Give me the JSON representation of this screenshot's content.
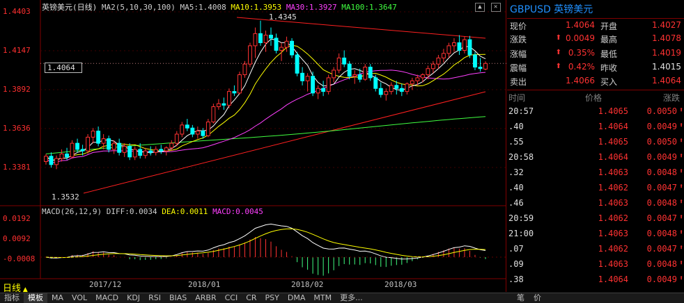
{
  "instrument": {
    "name": "英镑美元",
    "period": "日线",
    "code": "GBPUSD",
    "panel_title_name": "英镑美元"
  },
  "ma_header": {
    "title": "英镑美元(日线)",
    "ma2": "MA2(5,10,30,100)",
    "ma5": "MA5:1.4008",
    "ma10": "MA10:1.3953",
    "ma30": "MA30:1.3927",
    "ma100": "MA100:1.3647"
  },
  "macd_header": {
    "title": "MACD(26,12,9)",
    "diff": "DIFF:0.0034",
    "dea": "DEA:0.0011",
    "macd": "MACD:0.0045"
  },
  "price_axis": [
    "1.4403",
    "1.4147",
    "1.3892",
    "1.3636",
    "1.3381"
  ],
  "macd_axis": [
    "0.0192",
    "0.0092",
    "-0.0008"
  ],
  "x_axis": [
    "2017/12",
    "2018/01",
    "2018/02",
    "2018/03"
  ],
  "current_price_tag": "1.4064",
  "high_marker": "1.4345",
  "low_marker": "1.3532",
  "period_button": "日线",
  "window_controls": [
    "▲",
    "✕"
  ],
  "quote": {
    "rows": [
      {
        "l1": "现价",
        "v1": "1.4064",
        "v1_arrow": "",
        "l2": "开盘",
        "v2": "1.4027"
      },
      {
        "l1": "涨跌",
        "v1": "0.0049",
        "v1_arrow": "⬆",
        "l2": "最高",
        "v2": "1.4078"
      },
      {
        "l1": "涨幅",
        "v1": "0.35%",
        "v1_arrow": "⬆",
        "l2": "最低",
        "v2": "1.4019"
      },
      {
        "l1": "震幅",
        "v1": "0.42%",
        "v1_arrow": "⬆",
        "l2": "昨收",
        "v2": "1.4015"
      },
      {
        "l1": "卖出",
        "v1": "1.4066",
        "v1_arrow": "",
        "l2": "买入",
        "v2": "1.4064"
      }
    ]
  },
  "ticks_header": {
    "time": "时间",
    "price": "价格",
    "change": "涨跌"
  },
  "ticks": [
    {
      "time": "20:57",
      "price": "1.4065",
      "change": "0.0050"
    },
    {
      "time": ".40",
      "price": "1.4064",
      "change": "0.0049"
    },
    {
      "time": ".55",
      "price": "1.4065",
      "change": "0.0050"
    },
    {
      "time": "20:58",
      "price": "1.4064",
      "change": "0.0049"
    },
    {
      "time": ".32",
      "price": "1.4063",
      "change": "0.0048"
    },
    {
      "time": ".40",
      "price": "1.4062",
      "change": "0.0047"
    },
    {
      "time": ".46",
      "price": "1.4063",
      "change": "0.0048"
    },
    {
      "time": "20:59",
      "price": "1.4062",
      "change": "0.0047"
    },
    {
      "time": "21:00",
      "price": "1.4063",
      "change": "0.0048"
    },
    {
      "time": ".07",
      "price": "1.4062",
      "change": "0.0047"
    },
    {
      "time": ".09",
      "price": "1.4063",
      "change": "0.0048"
    },
    {
      "time": ".38",
      "price": "1.4064",
      "change": "0.0049"
    }
  ],
  "bottom_tabs": [
    "指标",
    "模板",
    "MA",
    "VOL",
    "MACD",
    "KDJ",
    "RSI",
    "BIAS",
    "ARBR",
    "CCI",
    "CR",
    "PSY",
    "DMA",
    "MTM",
    "更多..."
  ],
  "bottom_right_tabs": [
    "笔",
    "价"
  ],
  "colors": {
    "up": "#ff3232",
    "down": "#00ffff",
    "ma5": "#ffffff",
    "ma10": "#ffff00",
    "ma30": "#ff40ff",
    "ma100": "#40ff40",
    "trendline": "#ff2020"
  },
  "chart_data": {
    "type": "candlestick",
    "ylim": [
      1.3532,
      1.4403
    ],
    "candles": [
      [
        1.342,
        1.347,
        1.34,
        1.3455
      ],
      [
        1.3455,
        1.348,
        1.338,
        1.34
      ],
      [
        1.34,
        1.346,
        1.337,
        1.344
      ],
      [
        1.344,
        1.35,
        1.342,
        1.347
      ],
      [
        1.347,
        1.351,
        1.343,
        1.345
      ],
      [
        1.345,
        1.356,
        1.344,
        1.354
      ],
      [
        1.354,
        1.357,
        1.348,
        1.35
      ],
      [
        1.35,
        1.353,
        1.346,
        1.349
      ],
      [
        1.349,
        1.36,
        1.347,
        1.358
      ],
      [
        1.358,
        1.364,
        1.354,
        1.362
      ],
      [
        1.362,
        1.365,
        1.352,
        1.354
      ],
      [
        1.354,
        1.36,
        1.35,
        1.357
      ],
      [
        1.357,
        1.359,
        1.348,
        1.35
      ],
      [
        1.35,
        1.356,
        1.347,
        1.354
      ],
      [
        1.354,
        1.357,
        1.346,
        1.348
      ],
      [
        1.348,
        1.354,
        1.345,
        1.352
      ],
      [
        1.352,
        1.354,
        1.343,
        1.345
      ],
      [
        1.345,
        1.352,
        1.343,
        1.35
      ],
      [
        1.35,
        1.354,
        1.344,
        1.346
      ],
      [
        1.346,
        1.351,
        1.344,
        1.349
      ],
      [
        1.349,
        1.352,
        1.346,
        1.348
      ],
      [
        1.348,
        1.352,
        1.346,
        1.35
      ],
      [
        1.35,
        1.353,
        1.347,
        1.349
      ],
      [
        1.349,
        1.352,
        1.346,
        1.351
      ],
      [
        1.351,
        1.356,
        1.349,
        1.354
      ],
      [
        1.354,
        1.362,
        1.352,
        1.36
      ],
      [
        1.36,
        1.368,
        1.358,
        1.366
      ],
      [
        1.366,
        1.37,
        1.362,
        1.364
      ],
      [
        1.364,
        1.366,
        1.358,
        1.36
      ],
      [
        1.36,
        1.365,
        1.357,
        1.362
      ],
      [
        1.362,
        1.364,
        1.357,
        1.359
      ],
      [
        1.359,
        1.37,
        1.358,
        1.368
      ],
      [
        1.368,
        1.38,
        1.367,
        1.378
      ],
      [
        1.378,
        1.383,
        1.376,
        1.38
      ],
      [
        1.38,
        1.384,
        1.376,
        1.379
      ],
      [
        1.379,
        1.39,
        1.377,
        1.388
      ],
      [
        1.388,
        1.392,
        1.385,
        1.387
      ],
      [
        1.387,
        1.401,
        1.386,
        1.399
      ],
      [
        1.399,
        1.408,
        1.397,
        1.406
      ],
      [
        1.406,
        1.42,
        1.404,
        1.418
      ],
      [
        1.418,
        1.43,
        1.41,
        1.426
      ],
      [
        1.426,
        1.4345,
        1.418,
        1.42
      ],
      [
        1.42,
        1.428,
        1.414,
        1.425
      ],
      [
        1.425,
        1.43,
        1.418,
        1.423
      ],
      [
        1.423,
        1.426,
        1.413,
        1.415
      ],
      [
        1.415,
        1.42,
        1.408,
        1.417
      ],
      [
        1.417,
        1.424,
        1.414,
        1.421
      ],
      [
        1.421,
        1.423,
        1.41,
        1.412
      ],
      [
        1.412,
        1.414,
        1.398,
        1.4
      ],
      [
        1.4,
        1.404,
        1.392,
        1.395
      ],
      [
        1.395,
        1.4,
        1.388,
        1.398
      ],
      [
        1.398,
        1.401,
        1.385,
        1.387
      ],
      [
        1.387,
        1.392,
        1.383,
        1.39
      ],
      [
        1.39,
        1.395,
        1.385,
        1.388
      ],
      [
        1.388,
        1.399,
        1.386,
        1.397
      ],
      [
        1.397,
        1.404,
        1.394,
        1.402
      ],
      [
        1.402,
        1.413,
        1.4,
        1.41
      ],
      [
        1.41,
        1.415,
        1.404,
        1.406
      ],
      [
        1.406,
        1.408,
        1.396,
        1.398
      ],
      [
        1.398,
        1.402,
        1.393,
        1.399
      ],
      [
        1.399,
        1.403,
        1.394,
        1.396
      ],
      [
        1.396,
        1.406,
        1.395,
        1.404
      ],
      [
        1.404,
        1.406,
        1.395,
        1.397
      ],
      [
        1.397,
        1.399,
        1.388,
        1.39
      ],
      [
        1.39,
        1.394,
        1.384,
        1.386
      ],
      [
        1.386,
        1.39,
        1.382,
        1.388
      ],
      [
        1.388,
        1.394,
        1.386,
        1.392
      ],
      [
        1.392,
        1.395,
        1.386,
        1.39
      ],
      [
        1.39,
        1.393,
        1.385,
        1.388
      ],
      [
        1.388,
        1.394,
        1.386,
        1.393
      ],
      [
        1.393,
        1.397,
        1.389,
        1.395
      ],
      [
        1.395,
        1.399,
        1.392,
        1.397
      ],
      [
        1.397,
        1.4,
        1.394,
        1.399
      ],
      [
        1.399,
        1.405,
        1.396,
        1.403
      ],
      [
        1.403,
        1.408,
        1.4,
        1.406
      ],
      [
        1.406,
        1.412,
        1.403,
        1.41
      ],
      [
        1.41,
        1.416,
        1.407,
        1.413
      ],
      [
        1.413,
        1.42,
        1.41,
        1.418
      ],
      [
        1.418,
        1.423,
        1.414,
        1.42
      ],
      [
        1.42,
        1.425,
        1.412,
        1.415
      ],
      [
        1.415,
        1.424,
        1.413,
        1.422
      ],
      [
        1.422,
        1.4245,
        1.41,
        1.412
      ],
      [
        1.412,
        1.414,
        1.402,
        1.404
      ],
      [
        1.404,
        1.41,
        1.401,
        1.403
      ],
      [
        1.4027,
        1.4078,
        1.4019,
        1.4064
      ]
    ]
  }
}
